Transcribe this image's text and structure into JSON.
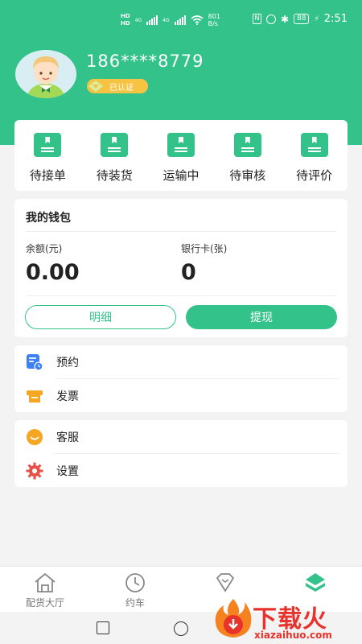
{
  "status_bar": {
    "hd1": "HD",
    "hd2": "HD",
    "net1": "4G",
    "net2": "4G",
    "speed_value": "801",
    "speed_unit": "B/s",
    "battery": "88",
    "time": "2:51"
  },
  "profile": {
    "phone": "186****8779",
    "verified_label": "已认证"
  },
  "orders": [
    {
      "label": "待接单"
    },
    {
      "label": "待装货"
    },
    {
      "label": "运输中"
    },
    {
      "label": "待审核"
    },
    {
      "label": "待评价"
    }
  ],
  "wallet": {
    "title": "我的钱包",
    "balance_label": "余额(元)",
    "balance_value": "0.00",
    "card_label": "银行卡(张)",
    "card_value": "0",
    "detail_button": "明细",
    "withdraw_button": "提现"
  },
  "menu": [
    {
      "label": "预约",
      "icon": "calendar-icon"
    },
    {
      "label": "发票",
      "icon": "invoice-icon"
    },
    {
      "label": "客服",
      "icon": "customer-service-icon"
    },
    {
      "label": "设置",
      "icon": "gear-icon"
    }
  ],
  "tabbar": [
    {
      "label": "配货大厅",
      "icon": "home-icon"
    },
    {
      "label": "约车",
      "icon": "clock-icon"
    },
    {
      "label": "",
      "icon": "diamond-icon"
    },
    {
      "label": "",
      "icon": "profile-tab-icon"
    }
  ],
  "watermark": {
    "text": "下载火",
    "sub": "xiazaihuo.com"
  },
  "colors": {
    "accent": "#34c28b",
    "gold": "#f6c343",
    "watermark_red": "#e8332d"
  }
}
